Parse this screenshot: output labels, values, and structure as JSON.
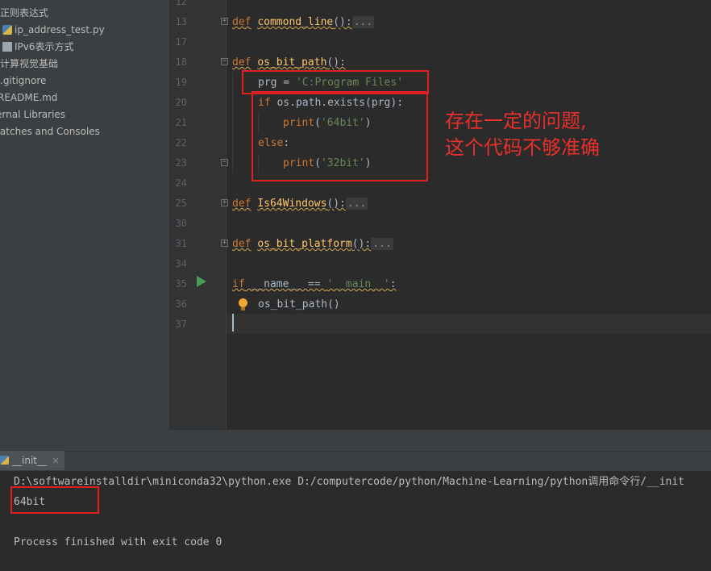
{
  "sidebar": {
    "items": [
      {
        "label": "正则表达式",
        "icon": "folder-icon"
      },
      {
        "label": "ip_address_test.py",
        "icon": "python-file-icon"
      },
      {
        "label": "IPv6表示方式",
        "icon": "file-icon"
      },
      {
        "label": "计算视觉基础",
        "icon": "folder-icon"
      },
      {
        "label": ".gitignore",
        "icon": "file-icon"
      },
      {
        "label": "README.md",
        "icon": "file-icon"
      },
      {
        "label": "ernal Libraries",
        "icon": "library-icon"
      },
      {
        "label": "ratches and Consoles",
        "icon": "scratch-icon"
      }
    ]
  },
  "editor": {
    "line_numbers": [
      "12",
      "13",
      "17",
      "18",
      "19",
      "20",
      "21",
      "22",
      "23",
      "24",
      "25",
      "30",
      "31",
      "34",
      "35",
      "36",
      "37"
    ],
    "code": {
      "l13_kw": "def",
      "l13_fn": "commond_line",
      "l13_tail": "():",
      "l13_dots": "...",
      "l18_kw": "def",
      "l18_fn": "os_bit_path",
      "l18_tail": "():",
      "l19_var": "prg = ",
      "l19_str": "'C:Program Files'",
      "l20_kw": "if",
      "l20_rest": " os.path.exists(prg):",
      "l21_fn": "print",
      "l21_open": "(",
      "l21_str": "'64bit'",
      "l21_close": ")",
      "l22_kw": "else",
      "l22_rest": ":",
      "l23_fn": "print",
      "l23_open": "(",
      "l23_str": "'32bit'",
      "l23_close": ")",
      "l25_kw": "def",
      "l25_fn": "Is64Windows",
      "l25_tail": "():",
      "l25_dots": "...",
      "l31_kw": "def",
      "l31_fn": "os_bit_platform",
      "l31_tail": "():",
      "l31_dots": "...",
      "l35_kw": "if",
      "l35_name": " __name__ == ",
      "l35_str": "'__main__'",
      "l35_tail": ":",
      "l36": "os_bit_path()"
    },
    "annotation": "存在一定的问题,\n这个代码不够准确"
  },
  "run": {
    "tab_label": "__init__",
    "tab_close": "×",
    "console": {
      "command": "D:\\softwareinstalldir\\miniconda32\\python.exe D:/computercode/python/Machine-Learning/python调用命令行/__init",
      "output": "64bit",
      "exit": "Process finished with exit code 0"
    }
  },
  "colors": {
    "keyword": "#cc7832",
    "function": "#ffc66d",
    "string": "#6a8759",
    "annotation": "#e8302a"
  }
}
